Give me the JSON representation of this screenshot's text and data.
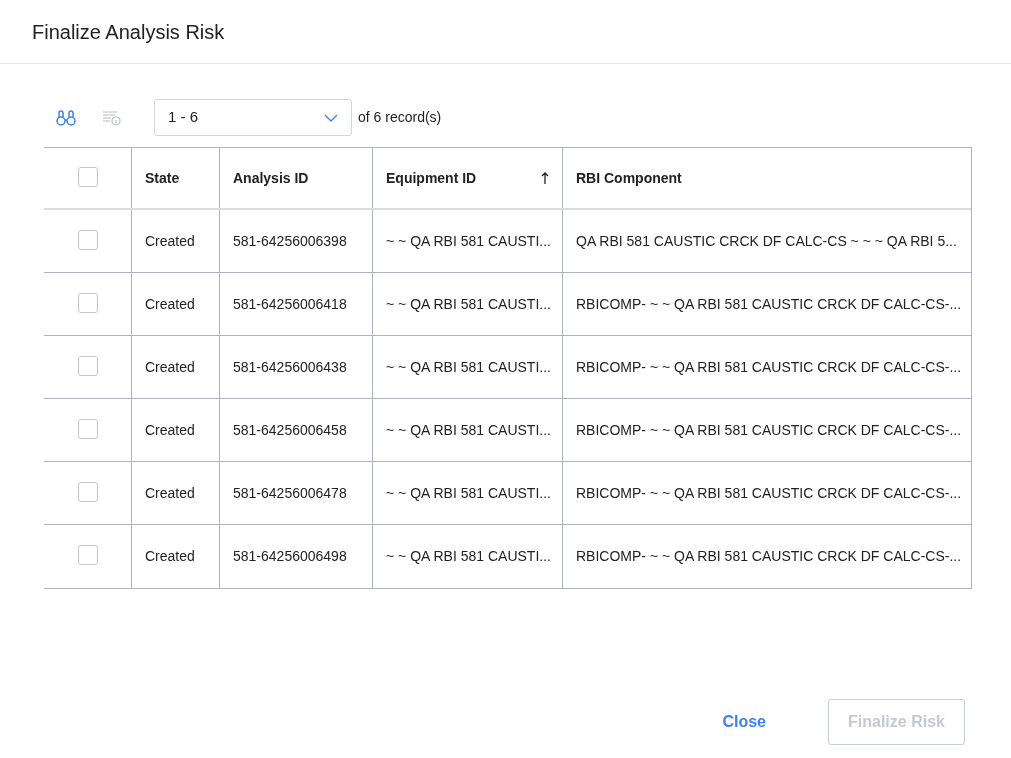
{
  "dialog": {
    "title": "Finalize Analysis Risk"
  },
  "toolbar": {
    "range": "1 - 6",
    "of": "of",
    "total": "6",
    "unit": "record(s)"
  },
  "table": {
    "select_all": {
      "checked": false
    },
    "columns": [
      {
        "label": "State",
        "sorted": false
      },
      {
        "label": "Analysis ID",
        "sorted": false
      },
      {
        "label": "Equipment ID",
        "sorted": true
      },
      {
        "label": "RBI Component",
        "sorted": false
      }
    ],
    "rows": [
      {
        "checked": false,
        "cells": [
          "Created",
          "581-64256006398",
          "~ ~ QA RBI 581 CAUSTI...",
          "QA RBI 581 CAUSTIC CRCK DF CALC-CS ~ ~ ~ QA RBI 5..."
        ]
      },
      {
        "checked": false,
        "cells": [
          "Created",
          "581-64256006418",
          "~ ~ QA RBI 581 CAUSTI...",
          "RBICOMP- ~ ~ QA RBI 581 CAUSTIC CRCK DF CALC-CS-..."
        ]
      },
      {
        "checked": false,
        "cells": [
          "Created",
          "581-64256006438",
          "~ ~ QA RBI 581 CAUSTI...",
          "RBICOMP- ~ ~ QA RBI 581 CAUSTIC CRCK DF CALC-CS-..."
        ]
      },
      {
        "checked": false,
        "cells": [
          "Created",
          "581-64256006458",
          "~ ~ QA RBI 581 CAUSTI...",
          "RBICOMP- ~ ~ QA RBI 581 CAUSTIC CRCK DF CALC-CS-..."
        ]
      },
      {
        "checked": false,
        "cells": [
          "Created",
          "581-64256006478",
          "~ ~ QA RBI 581 CAUSTI...",
          "RBICOMP- ~ ~ QA RBI 581 CAUSTIC CRCK DF CALC-CS-..."
        ]
      },
      {
        "checked": false,
        "cells": [
          "Created",
          "581-64256006498",
          "~ ~ QA RBI 581 CAUSTI...",
          "RBICOMP- ~ ~ QA RBI 581 CAUSTIC CRCK DF CALC-CS-..."
        ]
      }
    ]
  },
  "buttons": [
    {
      "label": "Close",
      "kind": "link",
      "disabled": false
    },
    {
      "label": "Finalize Risk",
      "kind": "outline",
      "disabled": true
    }
  ]
}
